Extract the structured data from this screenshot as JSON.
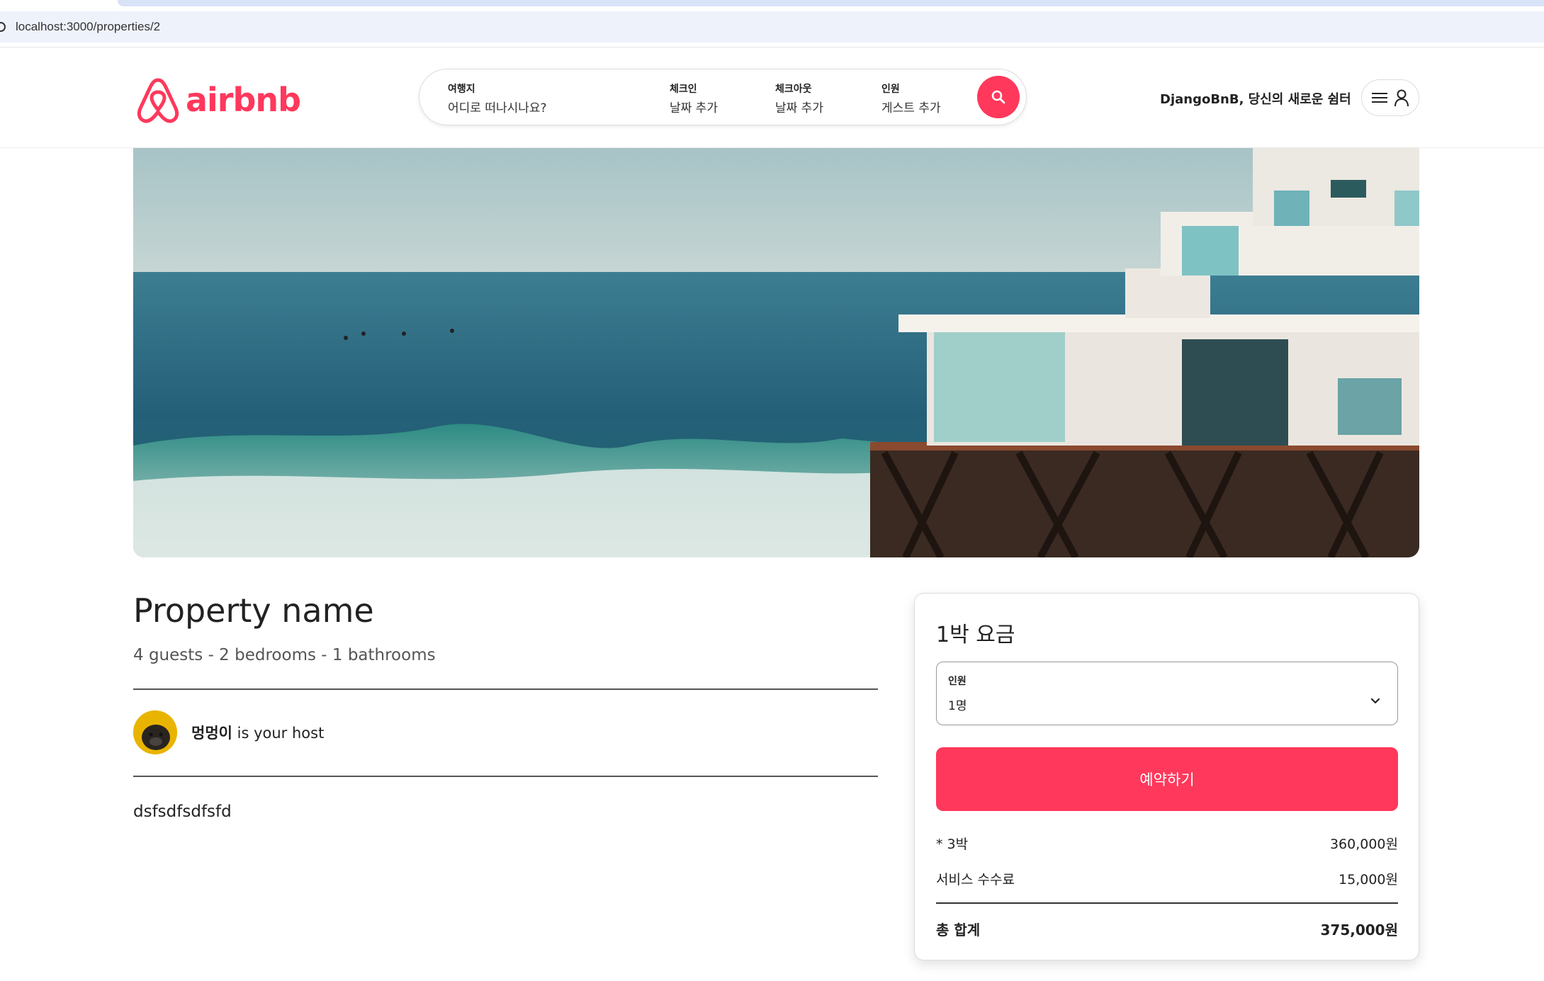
{
  "browser": {
    "url": "localhost:3000/properties/2"
  },
  "header": {
    "logo_text": "airbnb",
    "brand_color": "#ff385c",
    "search": {
      "destination_label": "여행지",
      "destination_placeholder": "어디로 떠나시나요?",
      "checkin_label": "체크인",
      "checkin_value": "날짜 추가",
      "checkout_label": "체크아웃",
      "checkout_value": "날짜 추가",
      "guests_label": "인원",
      "guests_value": "게스트 추가"
    },
    "tagline": "DjangoBnB, 당신의 새로운 쉼터"
  },
  "property": {
    "name": "Property name",
    "summary": "4 guests - 2 bedrooms - 1 bathrooms",
    "host_name": "멍멍이",
    "host_suffix": " is your host",
    "description": "dsfsdfsdfsfd"
  },
  "booking": {
    "title": "1박 요금",
    "guests_label": "인원",
    "guests_value": "1명",
    "reserve_label": "예약하기",
    "nights_label": "* 3박",
    "nights_amount": "360,000원",
    "fee_label": "서비스 수수료",
    "fee_amount": "15,000원",
    "total_label": "총 합계",
    "total_amount": "375,000원"
  }
}
